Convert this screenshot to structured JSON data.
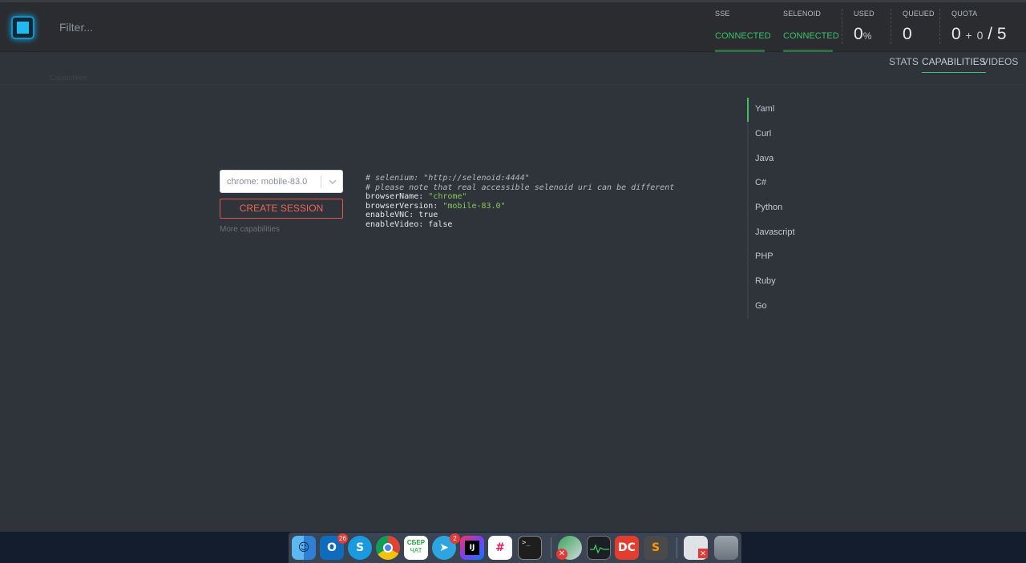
{
  "header": {
    "filter_placeholder": "Filter...",
    "sse": {
      "label": "SSE",
      "status": "CONNECTED"
    },
    "selenoid": {
      "label": "SELENOID",
      "status": "CONNECTED"
    },
    "used": {
      "label": "USED",
      "value": "0",
      "unit": "%"
    },
    "queued": {
      "label": "QUEUED",
      "value": "0"
    },
    "quota": {
      "label": "QUOTA",
      "value": "0",
      "plus": "+",
      "pending": "0",
      "slash": "/",
      "total": "5"
    }
  },
  "nav": {
    "tabs": [
      {
        "label": "STATS"
      },
      {
        "label": "CAPABILITIES"
      },
      {
        "label": "VIDEOS"
      }
    ],
    "breadcrumb": "Capabilities"
  },
  "capabilities": {
    "browser_select_value": "chrome: mobile-83.0",
    "create_button": "CREATE SESSION",
    "more_link": "More capabilities"
  },
  "code": {
    "comment1": "# selenium: \"http://selenoid:4444\"",
    "comment2": "# please note that real accessible selenoid uri can be different",
    "browser_name_key": "browserName: ",
    "browser_name_val": "\"chrome\"",
    "browser_version_key": "browserVersion: ",
    "browser_version_val": "\"mobile-83.0\"",
    "enable_vnc": "enableVNC: true",
    "enable_video": "enableVideo: false"
  },
  "languages": [
    "Yaml",
    "Curl",
    "Java",
    "C#",
    "Python",
    "Javascript",
    "PHP",
    "Ruby",
    "Go"
  ],
  "dock": {
    "outlook_badge": "26",
    "telegram_badge": "2",
    "sber_label_top": "СБЕР",
    "sber_label_bottom": "ЧАТ"
  },
  "colors": {
    "accent_green": "#3fc06a",
    "create_red": "#f0665a",
    "background": "#2f333a",
    "header": "#2a2c2f"
  }
}
